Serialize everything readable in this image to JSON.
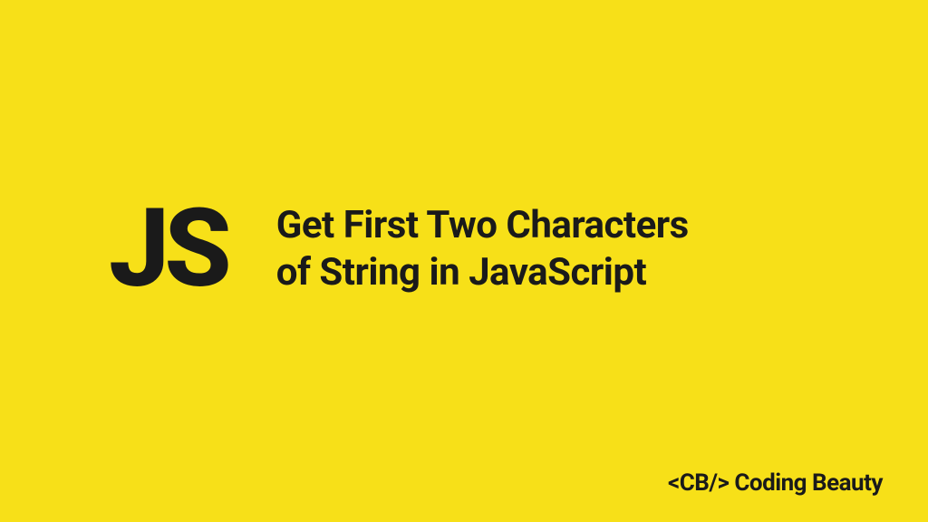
{
  "logo": "JS",
  "title_line1": "Get First Two Characters",
  "title_line2": "of String in JavaScript",
  "branding": "<CB/> Coding Beauty"
}
